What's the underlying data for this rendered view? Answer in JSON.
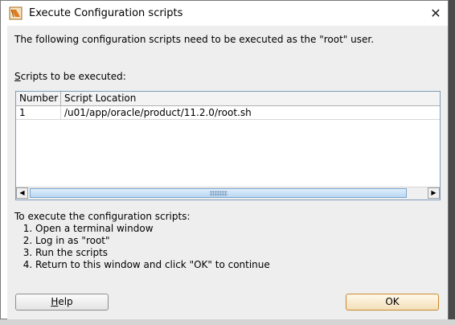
{
  "window": {
    "title": "Execute Configuration scripts",
    "close_glyph": "✕",
    "icon": "oracle-installer-icon"
  },
  "message": "The following configuration scripts need to be executed as the \"root\" user.",
  "scripts_label": {
    "mnemonic": "S",
    "rest": "cripts to be executed:"
  },
  "table": {
    "columns": [
      "Number",
      "Script Location"
    ],
    "rows": [
      {
        "number": "1",
        "location": "/u01/app/oracle/product/11.2.0/root.sh"
      }
    ]
  },
  "instructions": {
    "intro": "To execute the configuration scripts:",
    "steps": [
      "Open a terminal window",
      "Log in as \"root\"",
      "Run the scripts",
      "Return to this window and click \"OK\" to continue"
    ]
  },
  "buttons": {
    "help_mnemonic": "H",
    "help_rest": "elp",
    "ok": "OK"
  },
  "colors": {
    "ok_border": "#c78a2e",
    "scroll_thumb": "#b9d7f2",
    "dialog_bg": "#eeeeee"
  }
}
